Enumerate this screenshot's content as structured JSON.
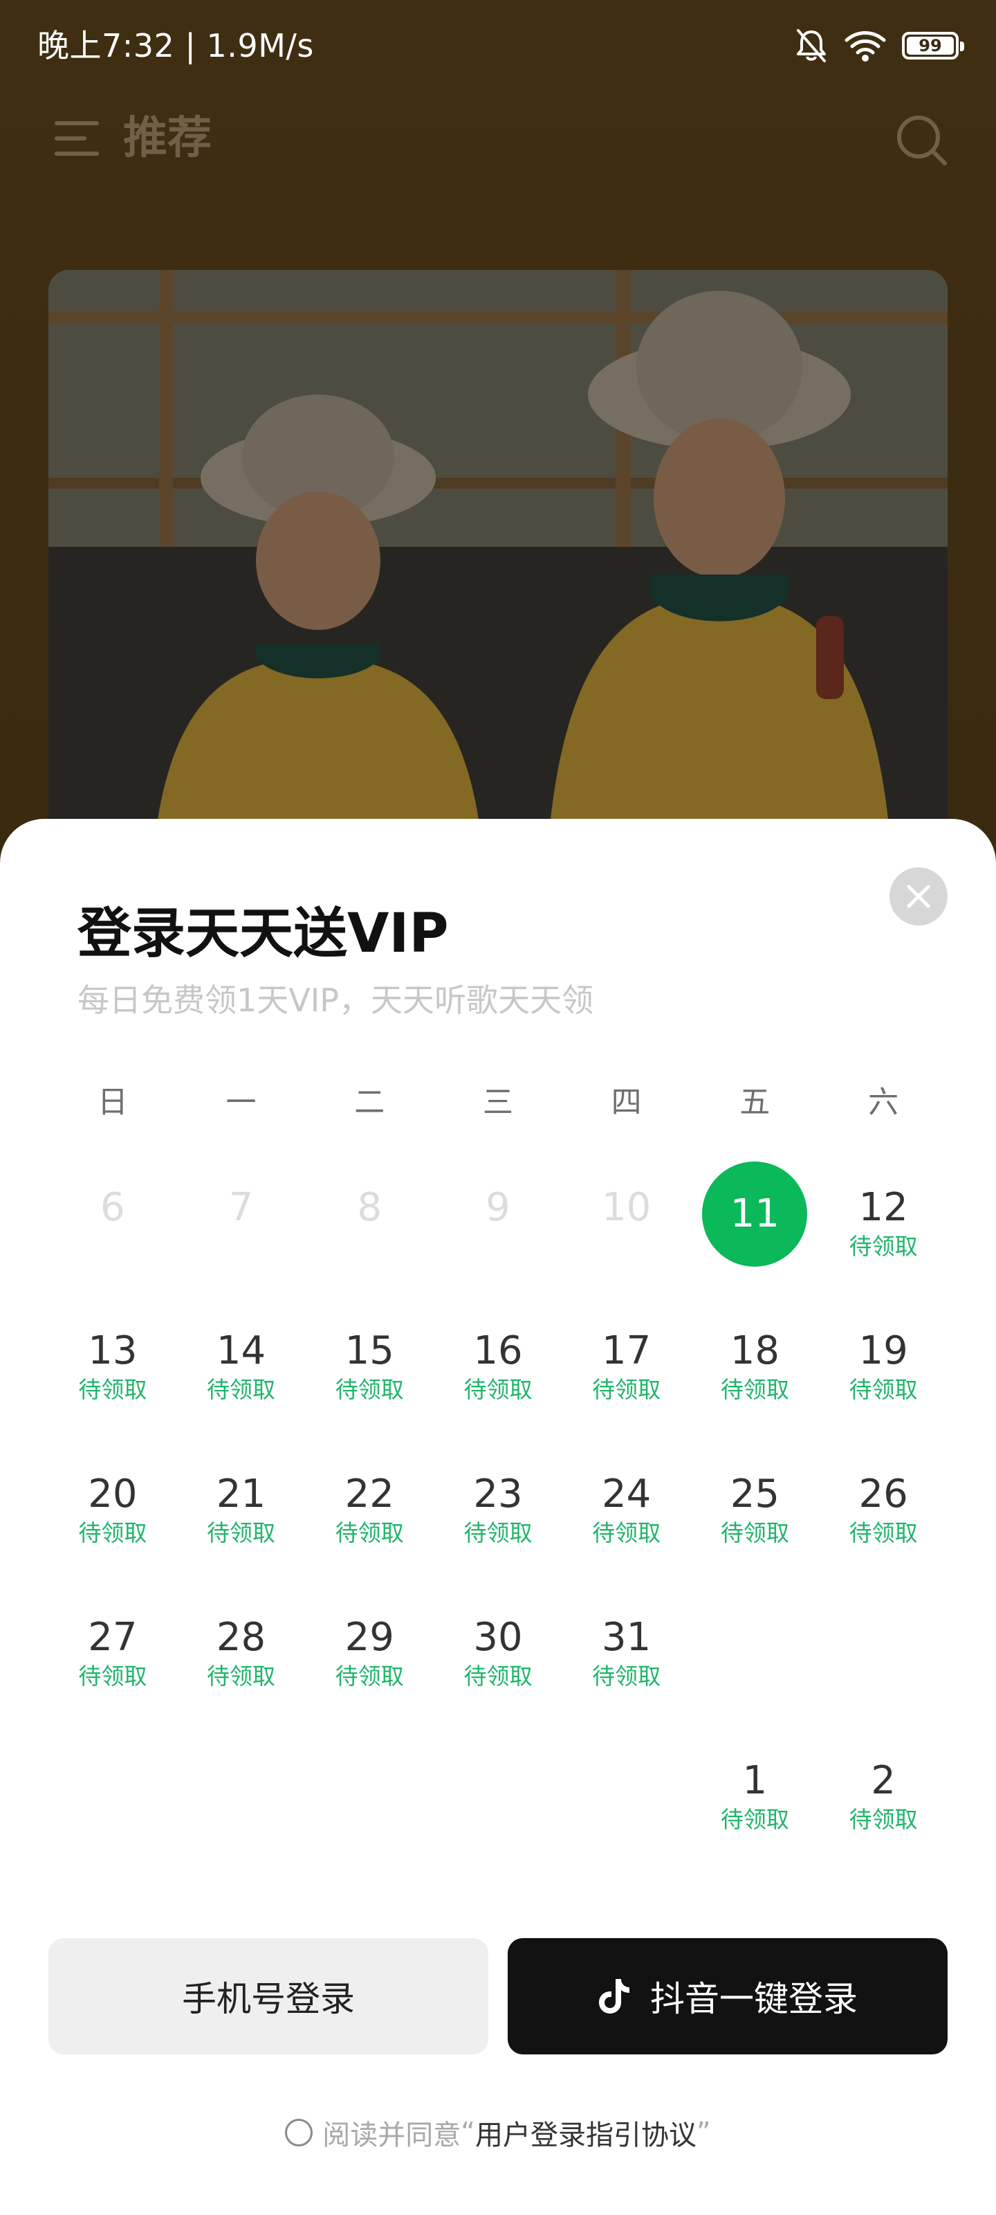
{
  "status_bar": {
    "time": "晚上7:32 | 1.9M/s",
    "battery": "99",
    "icons": [
      "bell-off-icon",
      "wifi-icon",
      "battery-icon"
    ]
  },
  "header": {
    "title": "推荐",
    "menu_icon": "menu-icon",
    "search_icon": "search-icon"
  },
  "sheet": {
    "title": "登录天天送VIP",
    "subtitle": "每日免费领1天VIP，天天听歌天天领",
    "weekdays": [
      "日",
      "一",
      "二",
      "三",
      "四",
      "五",
      "六"
    ],
    "claim_label": "待领取",
    "rows": [
      [
        {
          "day": "6",
          "state": "past"
        },
        {
          "day": "7",
          "state": "past"
        },
        {
          "day": "8",
          "state": "past"
        },
        {
          "day": "9",
          "state": "past"
        },
        {
          "day": "10",
          "state": "past"
        },
        {
          "day": "11",
          "state": "today"
        },
        {
          "day": "12",
          "state": "pending",
          "label": "待领取"
        }
      ],
      [
        {
          "day": "13",
          "state": "pending",
          "label": "待领取"
        },
        {
          "day": "14",
          "state": "pending",
          "label": "待领取"
        },
        {
          "day": "15",
          "state": "pending",
          "label": "待领取"
        },
        {
          "day": "16",
          "state": "pending",
          "label": "待领取"
        },
        {
          "day": "17",
          "state": "pending",
          "label": "待领取"
        },
        {
          "day": "18",
          "state": "pending",
          "label": "待领取"
        },
        {
          "day": "19",
          "state": "pending",
          "label": "待领取"
        }
      ],
      [
        {
          "day": "20",
          "state": "pending",
          "label": "待领取"
        },
        {
          "day": "21",
          "state": "pending",
          "label": "待领取"
        },
        {
          "day": "22",
          "state": "pending",
          "label": "待领取"
        },
        {
          "day": "23",
          "state": "pending",
          "label": "待领取"
        },
        {
          "day": "24",
          "state": "pending",
          "label": "待领取"
        },
        {
          "day": "25",
          "state": "pending",
          "label": "待领取"
        },
        {
          "day": "26",
          "state": "pending",
          "label": "待领取"
        }
      ],
      [
        {
          "day": "27",
          "state": "pending",
          "label": "待领取"
        },
        {
          "day": "28",
          "state": "pending",
          "label": "待领取"
        },
        {
          "day": "29",
          "state": "pending",
          "label": "待领取"
        },
        {
          "day": "30",
          "state": "pending",
          "label": "待领取"
        },
        {
          "day": "31",
          "state": "pending",
          "label": "待领取"
        },
        {
          "day": "",
          "state": "empty"
        },
        {
          "day": "",
          "state": "empty"
        }
      ],
      [
        {
          "day": "",
          "state": "empty"
        },
        {
          "day": "",
          "state": "empty"
        },
        {
          "day": "",
          "state": "empty"
        },
        {
          "day": "",
          "state": "empty"
        },
        {
          "day": "",
          "state": "empty"
        },
        {
          "day": "1",
          "state": "pending",
          "label": "待领取"
        },
        {
          "day": "2",
          "state": "pending",
          "label": "待领取"
        }
      ]
    ],
    "buttons": {
      "phone_login": "手机号登录",
      "douyin_login": "抖音一键登录"
    },
    "agreement": {
      "prefix": "阅读并同意",
      "open_quote": "“",
      "link": "用户登录指引协议",
      "close_quote": "”"
    }
  },
  "colors": {
    "accent_green": "#0bb85a",
    "claim_green": "#1fb56a",
    "dark_button": "#121212",
    "background_brown": "#3a2a12"
  }
}
